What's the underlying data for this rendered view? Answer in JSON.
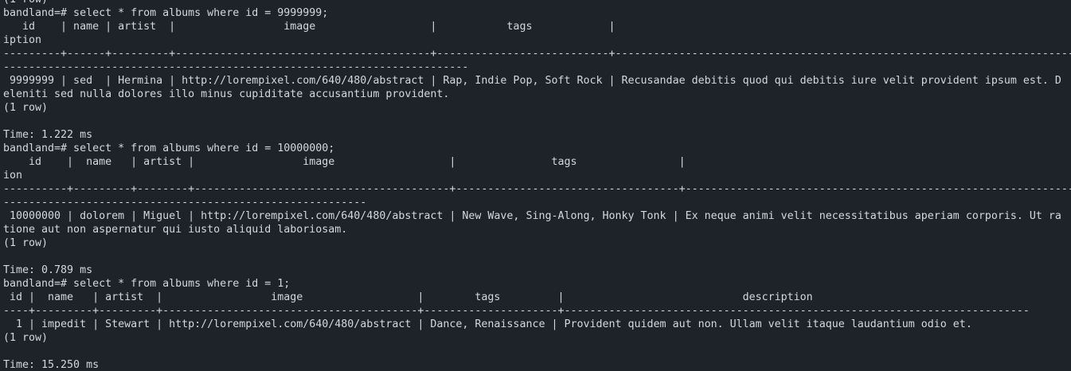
{
  "terminal": {
    "lines": [
      "(1 row)",
      "bandland=# select * from albums where id = 9999999;",
      "   id    | name | artist  |                 image                  |           tags            |                                                                                                           descr",
      "iption",
      "---------+------+---------+----------------------------------------+---------------------------+-------------------------------------------------------------------------------------------------------------------",
      "-------------------------------------------------------------------------",
      " 9999999 | sed  | Hermina | http://lorempixel.com/640/480/abstract | Rap, Indie Pop, Soft Rock | Recusandae debitis quod qui debitis iure velit provident ipsum est. D",
      "eleniti sed nulla dolores illo minus cupiditate accusantium provident.",
      "(1 row)",
      "",
      "Time: 1.222 ms",
      "bandland=# select * from albums where id = 10000000;",
      "    id    |  name   | artist |                 image                  |               tags                |                                                                                                  descript",
      "ion",
      "----------+---------+--------+----------------------------------------+-----------------------------------+-----------------------------------------------------------------------------------------------------------",
      "---------------------------------------------------------",
      " 10000000 | dolorem | Miguel | http://lorempixel.com/640/480/abstract | New Wave, Sing-Along, Honky Tonk | Ex neque animi velit necessitatibus aperiam corporis. Ut ra",
      "tione aut non aspernatur qui iusto aliquid laboriosam.",
      "(1 row)",
      "",
      "Time: 0.789 ms",
      "bandland=# select * from albums where id = 1;",
      " id |  name   | artist  |                 image                  |        tags         |                            description",
      "----+---------+---------+----------------------------------------+---------------------+-------------------------------------------------------------------------",
      "  1 | impedit | Stewart | http://lorempixel.com/640/480/abstract | Dance, Renaissance | Provident quidem aut non. Ullam velit itaque laudantium odio et.",
      "(1 row)",
      "",
      "Time: 15.250 ms"
    ],
    "prompt": "bandland=# "
  }
}
